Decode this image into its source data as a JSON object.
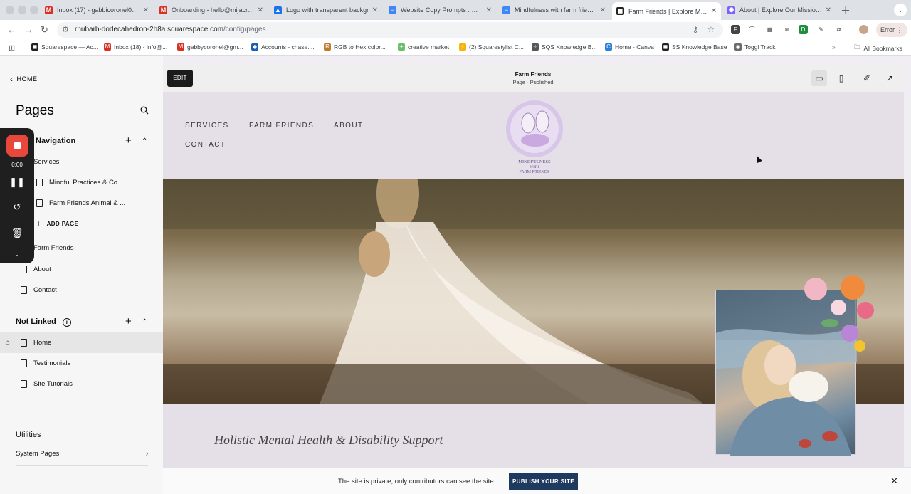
{
  "browser": {
    "tabs": [
      {
        "title": "Inbox (17) - gabbicoronel0@g",
        "icon": "gmail-icon",
        "color": "#d93025",
        "glyph": "M"
      },
      {
        "title": "Onboarding - hello@mijacrea",
        "icon": "gmail-icon",
        "color": "#d93025",
        "glyph": "M"
      },
      {
        "title": "Logo with transparent backgr",
        "icon": "google-drive-icon",
        "color": "#1a73e8",
        "glyph": "▲"
      },
      {
        "title": "Website Copy Prompts : mind",
        "icon": "google-docs-icon",
        "color": "#4285f4",
        "glyph": "≡"
      },
      {
        "title": "Mindfulness with farm friends",
        "icon": "google-docs-icon",
        "color": "#4285f4",
        "glyph": "≡"
      },
      {
        "title": "Farm Friends | Explore Mindfu",
        "icon": "squarespace-icon",
        "color": "#222222",
        "glyph": "◼"
      },
      {
        "title": "About | Explore Our Mission -",
        "icon": "flower-icon",
        "color": "#7b61ff",
        "glyph": "✺"
      }
    ],
    "url_domain": "rhubarb-dodecahedron-2h8a.squarespace.com",
    "url_path": "/config/pages",
    "error_label": "Error",
    "bookmarks": [
      {
        "label": "Squarespace — Ac...",
        "icon": "squarespace-icon",
        "color": "#222222",
        "glyph": "◼"
      },
      {
        "label": "Inbox (18) - info@...",
        "icon": "gmail-icon",
        "color": "#d93025",
        "glyph": "M"
      },
      {
        "label": "gabbycoronel@gm...",
        "icon": "gmail-icon",
        "color": "#d93025",
        "glyph": "M"
      },
      {
        "label": "Accounts - chase....",
        "icon": "chase-icon",
        "color": "#1a5fb4",
        "glyph": "◆"
      },
      {
        "label": "RGB to Hex color...",
        "icon": "rgb-icon",
        "color": "#c0792a",
        "glyph": "R"
      },
      {
        "label": "creative market",
        "icon": "creative-market-icon",
        "color": "#6cbf6a",
        "glyph": "✦"
      },
      {
        "label": "(2) Squarestylist C...",
        "icon": "lightning-icon",
        "color": "#f3b20c",
        "glyph": "⚡"
      },
      {
        "label": "SQS Knowledge B...",
        "icon": "sparkle-icon",
        "color": "#555555",
        "glyph": "✧"
      },
      {
        "label": "Home - Canva",
        "icon": "canva-icon",
        "color": "#2b7fd6",
        "glyph": "C"
      },
      {
        "label": "SS Knowledge Base",
        "icon": "squarespace-icon",
        "color": "#222222",
        "glyph": "◼"
      },
      {
        "label": "Toggl Track",
        "icon": "toggl-icon",
        "color": "#6b6b6b",
        "glyph": "◉"
      }
    ],
    "all_bookmarks": "All Bookmarks"
  },
  "sidebar": {
    "home_label": "HOME",
    "title": "Pages",
    "navigation": {
      "title": "Navigation",
      "items": [
        {
          "label": "Services",
          "nested": false
        },
        {
          "label": "Mindful Practices & Co...",
          "nested": true
        },
        {
          "label": "Farm Friends Animal & ...",
          "nested": true
        }
      ],
      "add_page": "ADD PAGE",
      "items_after": [
        {
          "label": "Farm Friends"
        },
        {
          "label": "About"
        },
        {
          "label": "Contact"
        }
      ]
    },
    "not_linked": {
      "title": "Not Linked",
      "items": [
        {
          "label": "Home"
        },
        {
          "label": "Testimonials"
        },
        {
          "label": "Site Tutorials"
        }
      ]
    },
    "utilities": "Utilities",
    "system_pages": "System Pages"
  },
  "recorder": {
    "time": "0:00"
  },
  "editor": {
    "edit_label": "EDIT",
    "page_name": "Farm Friends",
    "page_status": "Page · Published"
  },
  "site": {
    "nav": [
      "SERVICES",
      "FARM FRIENDS",
      "ABOUT",
      "CONTACT"
    ],
    "active_nav": "FARM FRIENDS",
    "logo_text": [
      "MINDFULNESS",
      "WITH",
      "FARM FRIENDS"
    ],
    "tagline": "Holistic Mental Health & Disability Support"
  },
  "banner": {
    "text": "The site is private, only contributors can see the site.",
    "publish_label": "PUBLISH YOUR SITE"
  },
  "colors": {
    "publish_button": "#1f3a5f",
    "recorder_stop": "#e8473c",
    "site_background": "#e5e0e7"
  }
}
